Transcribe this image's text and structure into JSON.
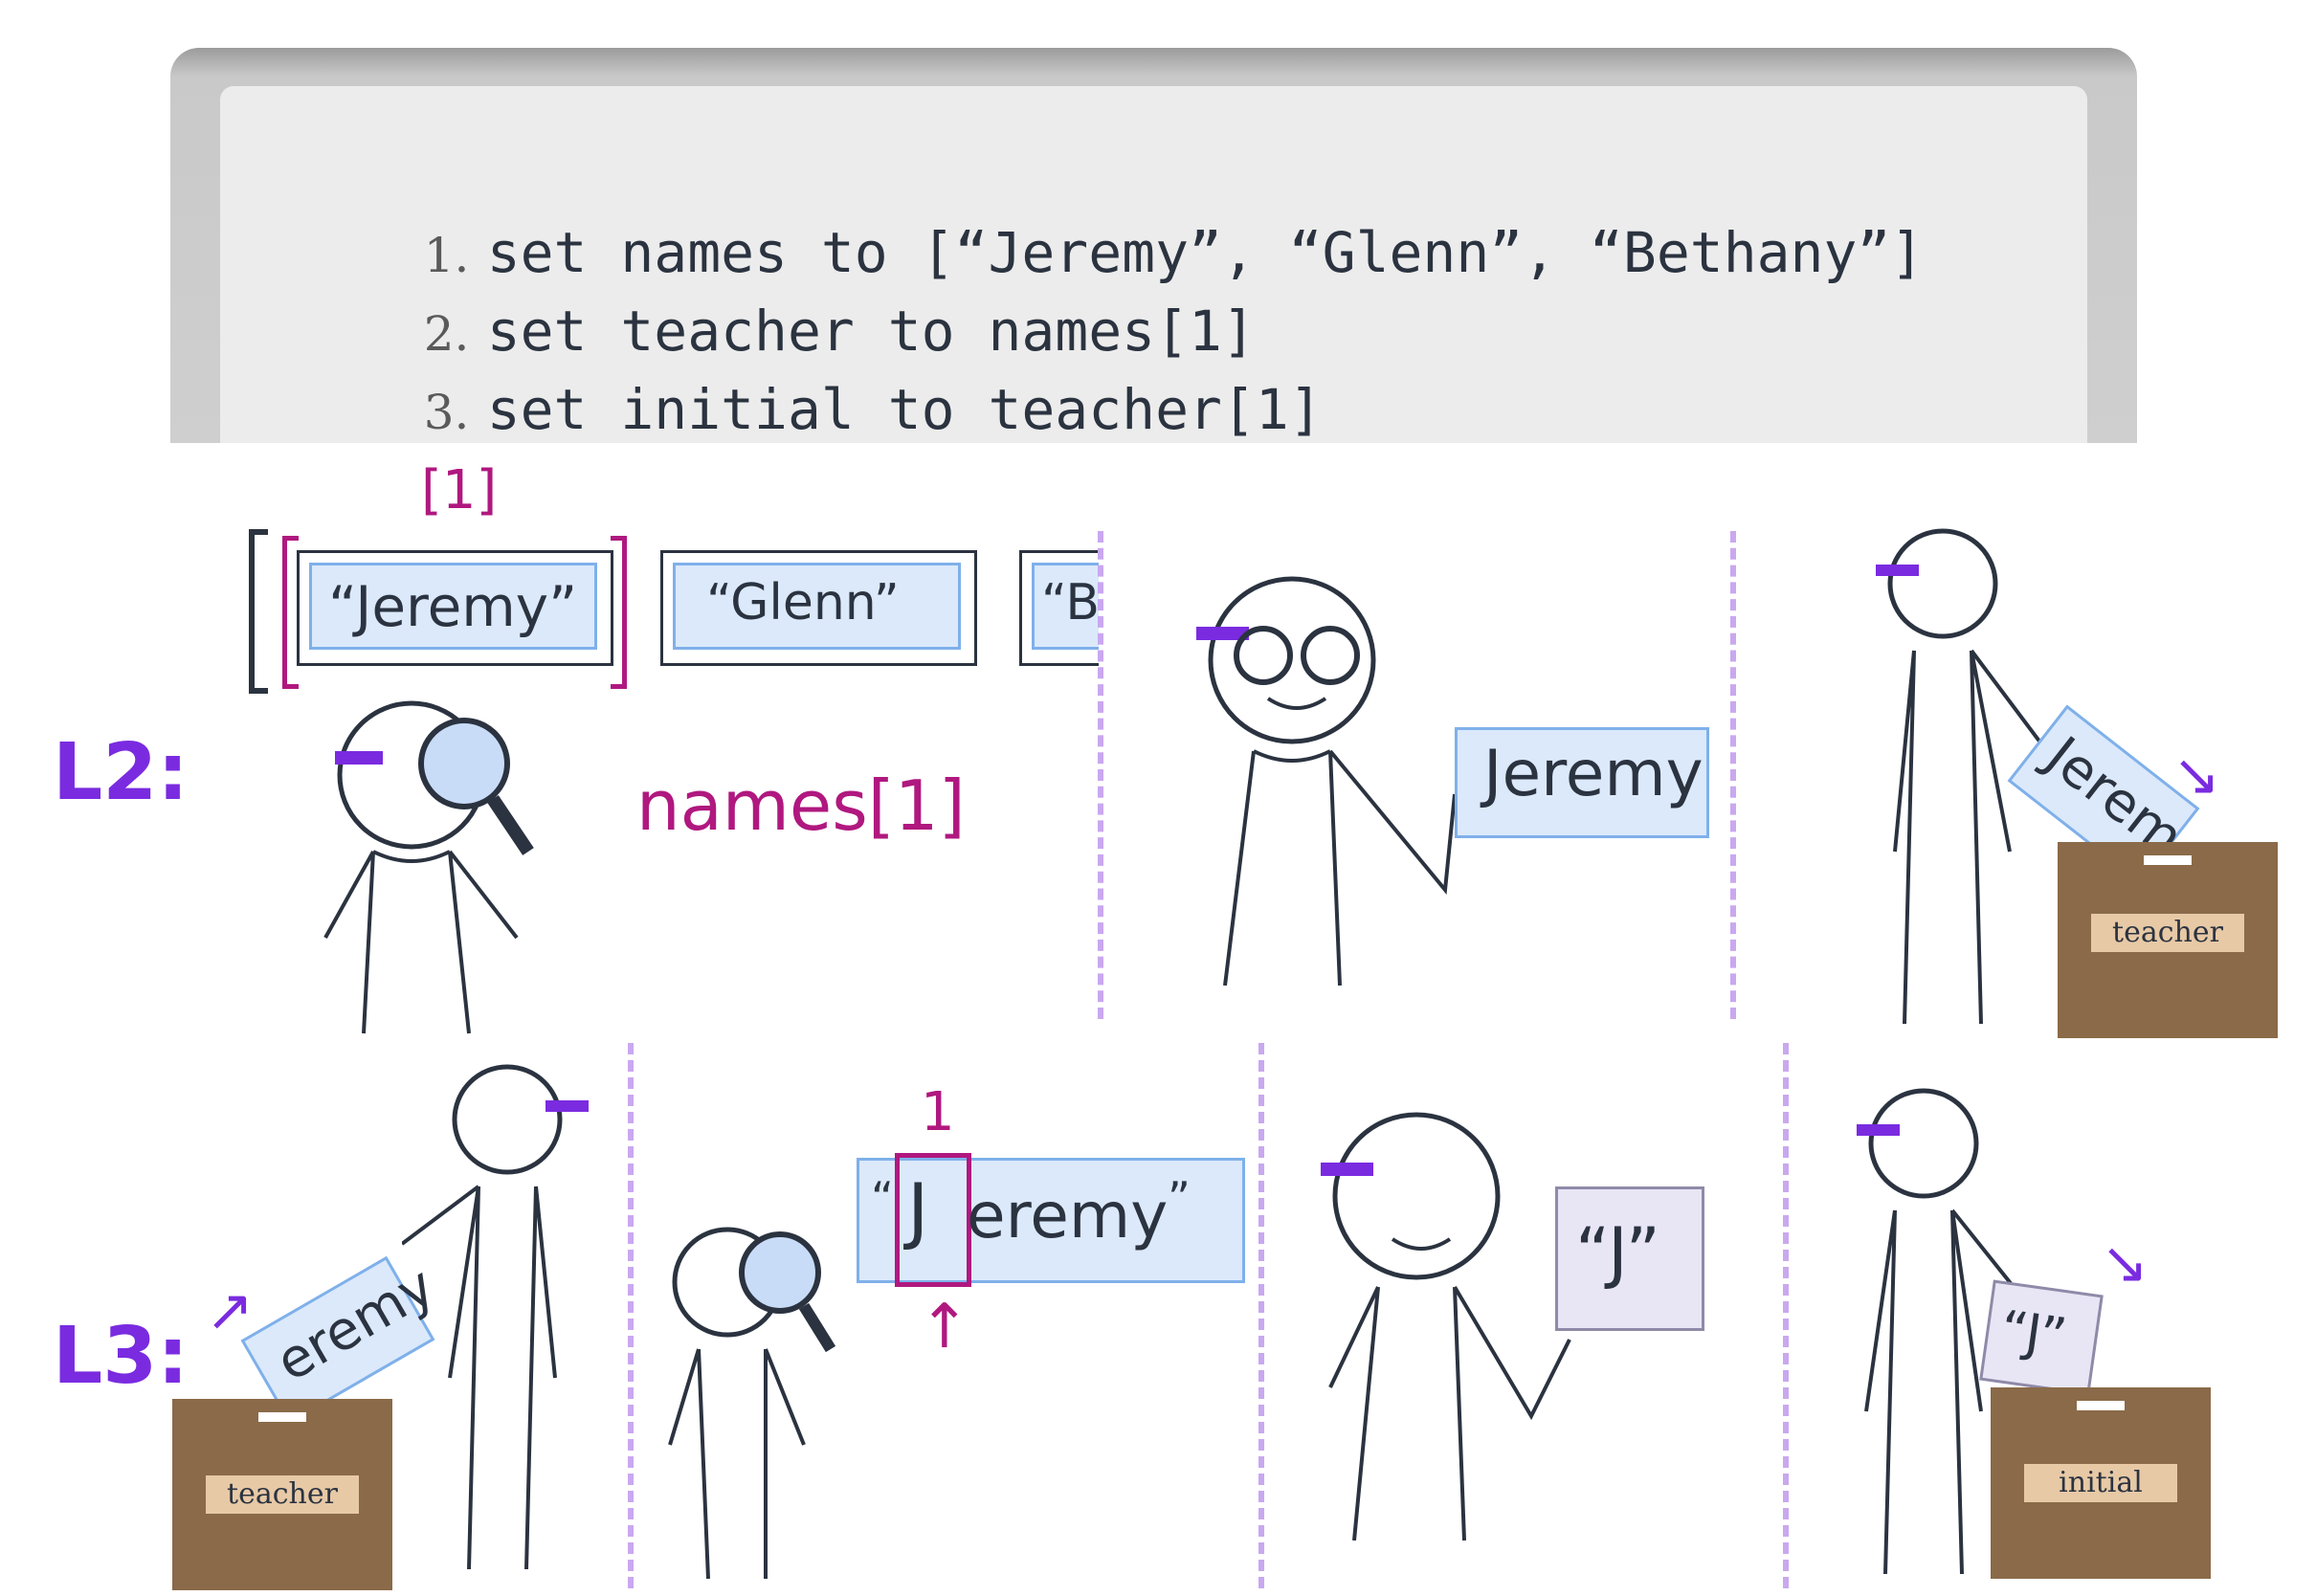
{
  "board": {
    "lines": [
      {
        "num": "1.",
        "code": "set names to [“Jeremy”, “Glenn”, “Bethany”]"
      },
      {
        "num": "2.",
        "code": "set teacher to names[1]"
      },
      {
        "num": "3.",
        "code": "set initial to teacher[1]"
      }
    ]
  },
  "row_labels": {
    "l2": "L2:",
    "l3": "L3:"
  },
  "array": {
    "index_label": "[1]",
    "items": [
      "“Jeremy”",
      "“Glenn”",
      "“B"
    ]
  },
  "expression": "names[1]",
  "paper_jeremy": "Jeremy",
  "paper_jerem": "Jerem",
  "paper_eremy": "eremy",
  "string_index": {
    "top": "1",
    "open_quote": "“",
    "first": "J",
    "rest": "eremy",
    "close_quote": "”"
  },
  "paper_j": "“J”",
  "boxes": {
    "teacher": "teacher",
    "teacher2": "teacher",
    "initial": "initial"
  },
  "colors": {
    "accent_purple": "#7a2be0",
    "magenta": "#b0187f",
    "box_brown": "#8a6a48",
    "label_tan": "#e7c9a6",
    "paper_blue": "#dbe9fb"
  }
}
